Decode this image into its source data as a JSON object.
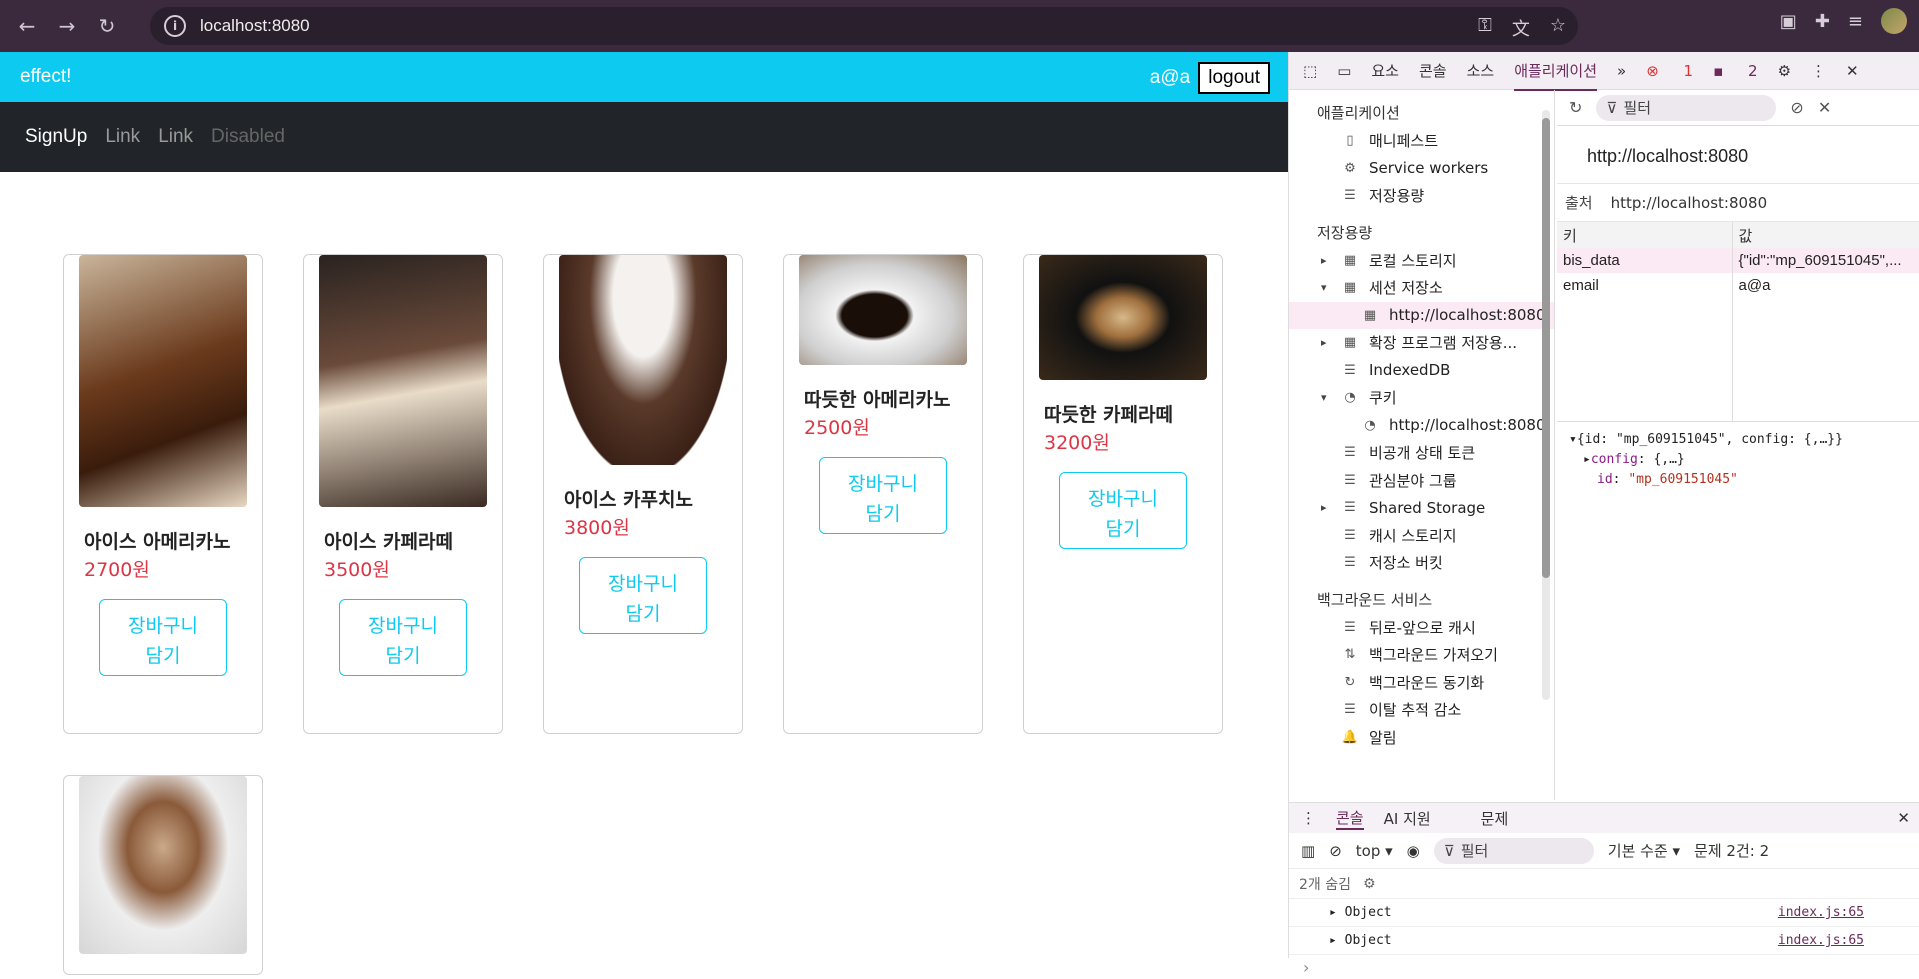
{
  "browser": {
    "url": "localhost:8080"
  },
  "app": {
    "brand": "effect!",
    "user_email": "a@a",
    "logout_label": "logout",
    "nav": [
      {
        "label": "SignUp"
      },
      {
        "label": "Link"
      },
      {
        "label": "Link"
      },
      {
        "label": "Disabled"
      }
    ],
    "add_to_cart_label_line1": "장바구니",
    "add_to_cart_label_line2": "담기",
    "products": [
      {
        "name": "아이스 아메리카노",
        "price": "2700원",
        "image": "iced-americano-image"
      },
      {
        "name": "아이스 카페라떼",
        "price": "3500원",
        "image": "iced-cafe-latte-image"
      },
      {
        "name": "아이스 카푸치노",
        "price": "3800원",
        "image": "iced-cappuccino-image"
      },
      {
        "name": "따듯한 아메리카노",
        "price": "2500원",
        "image": "hot-americano-image"
      },
      {
        "name": "따듯한 카페라떼",
        "price": "3200원",
        "image": "hot-cafe-latte-image"
      },
      {
        "name": "",
        "price": "",
        "image": "cappuccino-image"
      }
    ]
  },
  "devtools": {
    "tabs": [
      "요소",
      "콘솔",
      "소스",
      "애플리케이션"
    ],
    "selected_tab": "애플리케이션",
    "issue_counts": {
      "errors": "1",
      "messages": "2"
    },
    "sidebar": {
      "section_app": "애플리케이션",
      "app_items": [
        "매니페스트",
        "Service workers",
        "저장용량"
      ],
      "section_storage": "저장용량",
      "storage_items": [
        "로컬 스토리지",
        "세션 저장소",
        "http://localhost:8080",
        "확장 프로그램 저장용...",
        "IndexedDB",
        "쿠키",
        "http://localhost:8080",
        "비공개 상태 토큰",
        "관심분야 그룹",
        "Shared Storage",
        "캐시 스토리지",
        "저장소 버킷"
      ],
      "section_bg": "백그라운드 서비스",
      "bg_items": [
        "뒤로-앞으로 캐시",
        "백그라운드 가져오기",
        "백그라운드 동기화",
        "이탈 추적 감소",
        "알림"
      ]
    },
    "panel": {
      "filter_placeholder": "필터",
      "origin_title": "http://localhost:8080",
      "origin_label": "출처",
      "origin_value": "http://localhost:8080",
      "col_key": "키",
      "col_value": "값",
      "rows": [
        {
          "key": "bis_data",
          "value": "{\"id\":\"mp_609151045\",..."
        },
        {
          "key": "email",
          "value": "a@a"
        }
      ],
      "preview_line1": "{id: \"mp_609151045\", config: {,…}}",
      "preview_config_key": "config",
      "preview_config_val": "{,…}",
      "preview_id_key": "id",
      "preview_id_val": "\"mp_609151045\""
    },
    "drawer": {
      "tabs": [
        "콘솔",
        "AI 지원",
        "문제"
      ],
      "context": "top",
      "filter_placeholder": "필터",
      "level": "기본 수준",
      "issues": "문제 2건:",
      "issues_count": "2",
      "hidden": "2개 숨김",
      "logs": [
        {
          "text": "Object",
          "src": "index.js:65"
        },
        {
          "text": "Object",
          "src": "index.js:65"
        }
      ],
      "prompt": "›"
    }
  }
}
